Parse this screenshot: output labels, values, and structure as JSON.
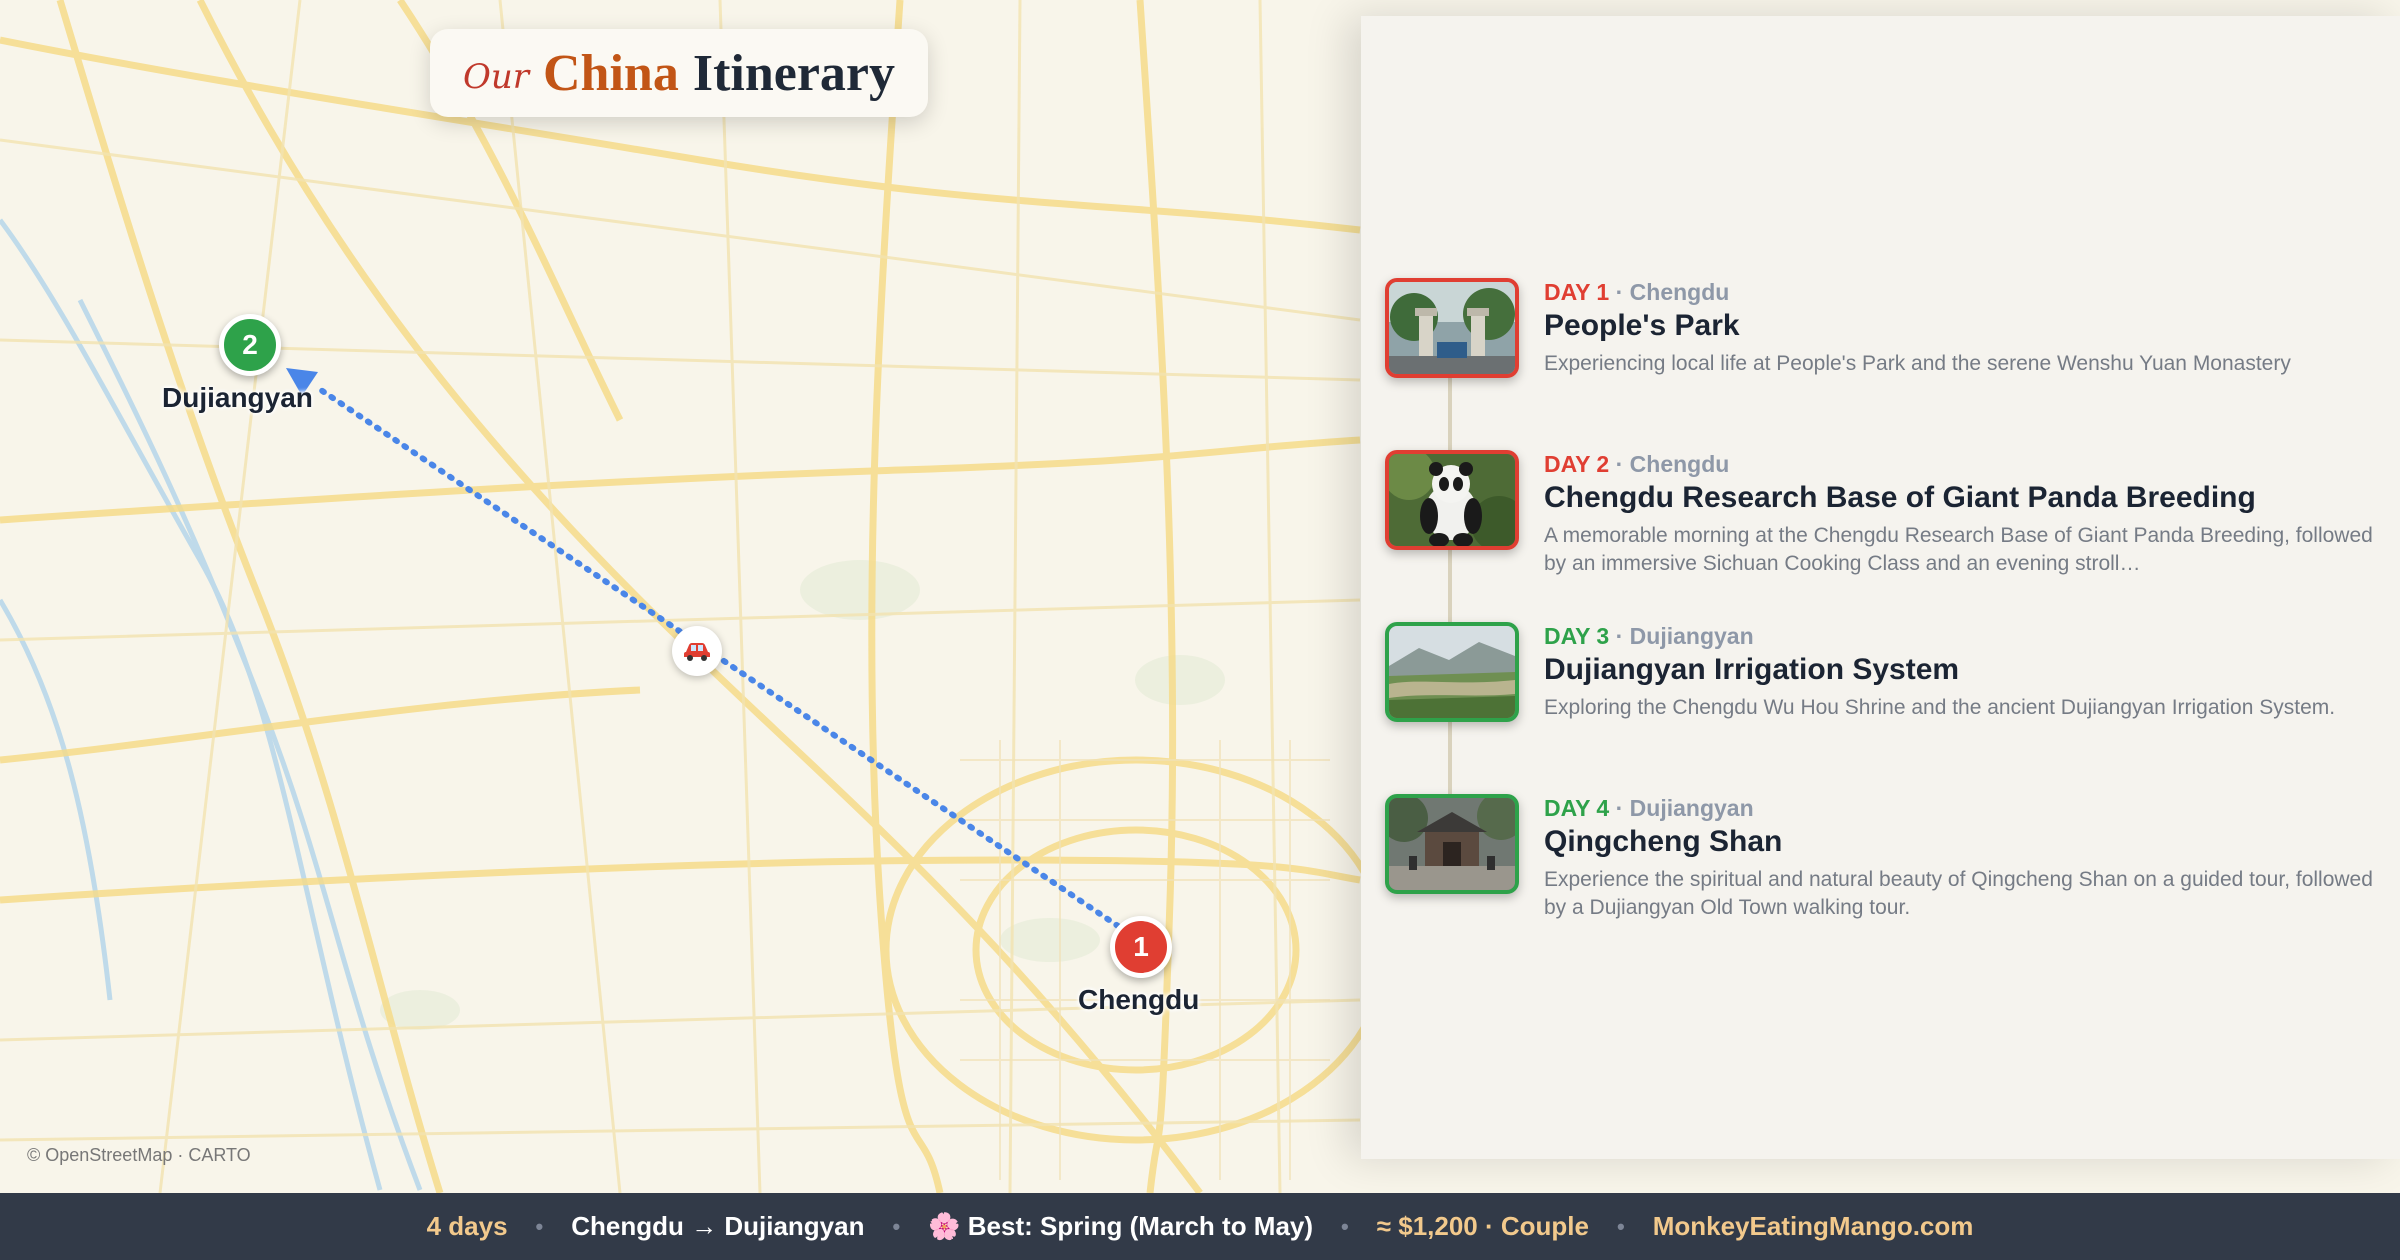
{
  "title": {
    "our": "Our",
    "china": "China",
    "rest": "Itinerary"
  },
  "map": {
    "attribution": "© OpenStreetMap · CARTO",
    "places": [
      {
        "number": "1",
        "name": "Chengdu",
        "color": "#e03e32"
      },
      {
        "number": "2",
        "name": "Dujiangyan",
        "color": "#2ea24a"
      }
    ],
    "route_color": "#4a86e8",
    "transport_icon": "car-icon"
  },
  "days": [
    {
      "label": "DAY 1",
      "city": "Chengdu",
      "title": "People's Park",
      "description": "Experiencing local life at People's Park and the serene Wenshu Yuan Monastery",
      "photo": "park-gate-photo",
      "accent": "#e03e32"
    },
    {
      "label": "DAY 2",
      "city": "Chengdu",
      "title": "Chengdu Research Base of Giant Panda Breeding",
      "description": "A memorable morning at the Chengdu Research Base of Giant Panda Breeding, followed by an immersive Sichuan Cooking Class and an evening stroll…",
      "photo": "panda-photo",
      "accent": "#e03e32"
    },
    {
      "label": "DAY 3",
      "city": "Dujiangyan",
      "title": "Dujiangyan Irrigation System",
      "description": "Exploring the Chengdu Wu Hou Shrine and the ancient Dujiangyan Irrigation System.",
      "photo": "river-valley-photo",
      "accent": "#2ea24a"
    },
    {
      "label": "DAY 4",
      "city": "Dujiangyan",
      "title": "Qingcheng Shan",
      "description": "Experience the spiritual and natural beauty of Qingcheng Shan on a guided tour, followed by a Dujiangyan Old Town walking tour.",
      "photo": "temple-photo",
      "accent": "#2ea24a"
    }
  ],
  "footer": {
    "duration": "4 days",
    "route": "Chengdu → Dujiangyan",
    "season": "🌸 Best: Spring (March to May)",
    "budget": "≈ $1,200 · Couple",
    "site": "MonkeyEatingMango.com"
  }
}
